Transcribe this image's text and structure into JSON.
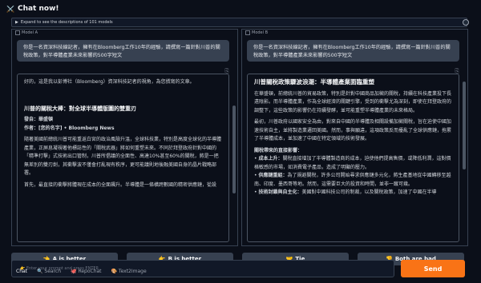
{
  "header": {
    "icon": "swords-icon",
    "title": "Chat now!"
  },
  "expand_label": "Expand to see the descriptions of 101 models",
  "model_a": {
    "label": "Model A",
    "prompt": "你是一名資深科技線記者，擁有在Bloomberg工作10年的經驗，請撰寫一篇針對川普的關稅政策，對半導體產業未來影響的500字短文",
    "intro": "好的，這是我以彭博社（Bloomberg）資深科技記者的視角，為您撰寫的文章。",
    "headline": "川普的關稅大棒：對全球半導體版圖的雙重刃",
    "byline_1": "發自：華盛頓",
    "byline_2": "作者：[您的名字] • Bloomberg News",
    "para1": "隨著美國前總統川普可能重返白宮的政治風險升溫，全球科技業，特別是高度全球化的半導體產業，正屏息凝視著他標誌性的「關稅武器」將如何重塑未來。不同於拜登政府針對中國的「精準打擊」式技術出口管制，川普所倡議的全面性、高達10%甚至60%的關稅，將是一把無差別的雙刃劍，其衝擊波不僅會打亂現有秩序，更可能議則地後融美國自身的晶片戰略部署。",
    "para2": "首先，最直接的衝擊將體現在成本的全面飆升。半導體是一條橫跨數國的精密供應鏈，從設"
  },
  "model_b": {
    "label": "Model B",
    "prompt": "你是一名資深科技線記者，擁有在Bloomberg工作10年的經驗，請撰寫一篇針對川普的關稅政策，對半導體產業未來影響的500字短文",
    "headline": "川普關稅政策驟波浪潮：半導體產業面臨重塑",
    "para1": "在華盛頓，前總統川普的貿易政策，特別是針對中國商品加徵的關稅，持續在科技產業投下長遠陰影。而半導體產業，作為全球經濟的關鍵引擎，受到的衝擊尤為深刻，即使在拜登政府的調整下，這些政策的影響仍在持續發酵，並可能重塑半導體產業的未來格局。",
    "para2": "最初，川普政府以國家安全為由，對來自中國的半導體及相關設備加徵關稅，旨在迫使中國加速技術自主，並將製造業遷回美國。然而，事與願違，這項政策反而擾亂了全球供應鏈，拖累了半導體成本，並加速了中國在特定領域的技術發展。",
    "section": "關稅帶來的直接影響：",
    "bullet1_head": "成本上升：",
    "bullet1": "關稅直接增加了半導體製造商的成本，迫使他們提高售價，或降低利潤，這對價格敏感的市場，如消費電子產品，造成了明顯的壓力。",
    "bullet2_head": "供應鏈重組：",
    "bullet2": "為了規避關稅，許多公司開始尋求供應鏈多元化，將生產基地從中國轉移至越南、印度、墨西哥等地。然而，這需要巨大的投資和時間，並非一蹴可幾。",
    "bullet3_head": "技術封鎖與自主化：",
    "bullet3": "美國對中國科技公司的制裁，以及關稅政策，加速了中國在半導"
  },
  "votes": {
    "a": {
      "icon": "point-left-icon",
      "glyph": "👈",
      "label": "A is better"
    },
    "b": {
      "icon": "point-right-icon",
      "glyph": "👉",
      "label": "B is better"
    },
    "tie": {
      "icon": "handshake-icon",
      "glyph": "🤝",
      "label": "Tie"
    },
    "bad": {
      "icon": "thumbs-down-icon",
      "glyph": "👎",
      "label": "Both are bad"
    }
  },
  "tabs": [
    "Chat",
    "Search",
    "RepoChat",
    "Text2Image"
  ],
  "input_placeholder": "👉 Enter your prompt and press ENTER",
  "send_label": "Send"
}
